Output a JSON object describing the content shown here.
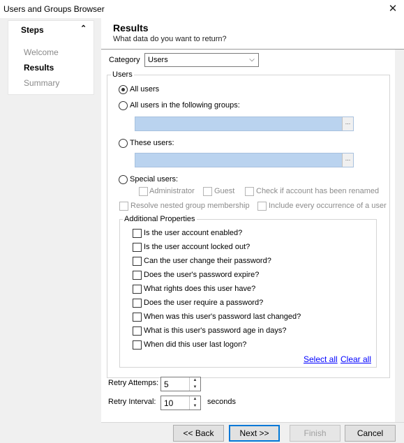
{
  "window": {
    "title": "Users and Groups Browser",
    "close_glyph": "✕"
  },
  "steps": {
    "title": "Steps",
    "collapse_glyph": "⌃",
    "items": [
      {
        "label": "Welcome",
        "state": "done"
      },
      {
        "label": "Results",
        "state": "active"
      },
      {
        "label": "Summary",
        "state": "pending"
      }
    ]
  },
  "header": {
    "title": "Results",
    "subtitle": "What data do you want to return?"
  },
  "category": {
    "label": "Category",
    "value": "Users",
    "arrow": "⌵"
  },
  "users_group": {
    "label": "Users",
    "radios": [
      {
        "label": "All users",
        "checked": true
      },
      {
        "label": "All users in the following groups:",
        "checked": false
      },
      {
        "label": "These users:",
        "checked": false
      },
      {
        "label": "Special users:",
        "checked": false
      }
    ],
    "picker_btn": "...",
    "special": [
      {
        "label": "Administrator"
      },
      {
        "label": "Guest"
      },
      {
        "label": "Check if account has been renamed"
      }
    ],
    "options": [
      {
        "label": "Resolve nested group membership"
      },
      {
        "label": "Include every occurrence of a user"
      }
    ]
  },
  "additional": {
    "label": "Additional Properties",
    "items": [
      "Is the user account enabled?",
      "Is the user account locked out?",
      "Can the user change their password?",
      "Does the user's password expire?",
      "What rights does this user have?",
      "Does the user require a password?",
      "When was this user's password last changed?",
      "What is this user's password age in days?",
      "When did this user last logon?"
    ],
    "select_all": "Select all",
    "clear_all": "Clear all"
  },
  "retry": {
    "attempts_label": "Retry Attemps:",
    "attempts_value": "5",
    "interval_label": "Retry Interval:",
    "interval_value": "10",
    "interval_unit": "seconds"
  },
  "buttons": {
    "back": "<< Back",
    "next": "Next >>",
    "finish": "Finish",
    "cancel": "Cancel"
  }
}
